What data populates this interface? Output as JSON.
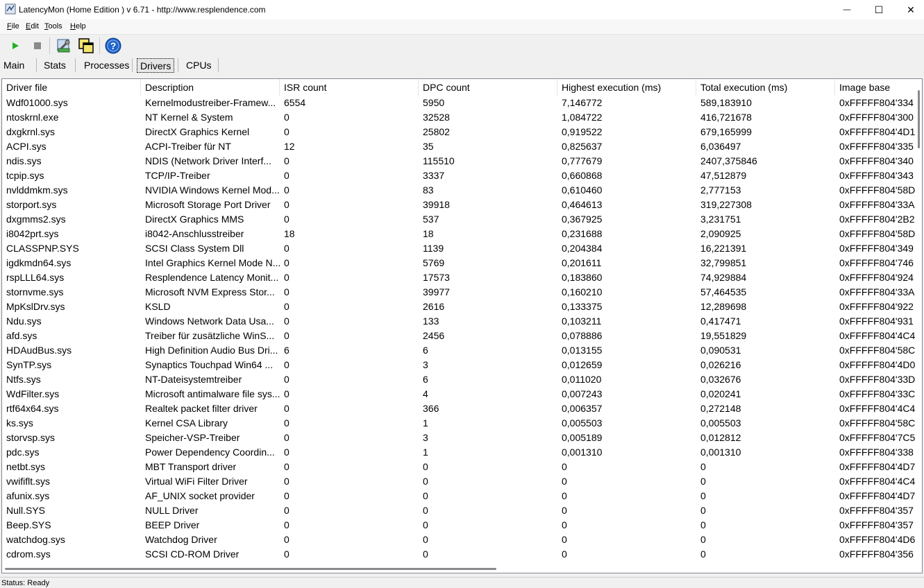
{
  "window": {
    "title": "LatencyMon  (Home Edition )  v 6.71 - http://www.resplendence.com",
    "minimize_glyph": "—",
    "maximize_glyph": "☐",
    "close_glyph": "✕"
  },
  "menu": [
    {
      "label": "File",
      "accel": "F",
      "rest": "ile"
    },
    {
      "label": "Edit",
      "accel": "E",
      "rest": "dit"
    },
    {
      "label": "Tools",
      "accel": "T",
      "rest": "ools"
    },
    {
      "label": "Help",
      "accel": "H",
      "rest": "elp"
    }
  ],
  "toolbar": {
    "icons": [
      "play-icon",
      "stop-icon",
      "tools-icon",
      "window-icon",
      "help-icon"
    ]
  },
  "tabs": [
    {
      "label": "Main",
      "active": false
    },
    {
      "label": "Stats",
      "active": false
    },
    {
      "label": "Processes",
      "active": false
    },
    {
      "label": "Drivers",
      "active": true
    },
    {
      "label": "CPUs",
      "active": false
    }
  ],
  "columns": [
    "Driver file",
    "Description",
    "ISR count",
    "DPC count",
    "Highest execution (ms)",
    "Total execution (ms)",
    "Image base"
  ],
  "rows": [
    [
      "Wdf01000.sys",
      "Kernelmodustreiber-Framew...",
      "6554",
      "5950",
      "7,146772",
      "589,183910",
      "0xFFFFF804'334"
    ],
    [
      "ntoskrnl.exe",
      "NT Kernel & System",
      "0",
      "32528",
      "1,084722",
      "416,721678",
      "0xFFFFF804'300"
    ],
    [
      "dxgkrnl.sys",
      "DirectX Graphics Kernel",
      "0",
      "25802",
      "0,919522",
      "679,165999",
      "0xFFFFF804'4D1"
    ],
    [
      "ACPI.sys",
      "ACPI-Treiber für NT",
      "12",
      "35",
      "0,825637",
      "6,036497",
      "0xFFFFF804'335"
    ],
    [
      "ndis.sys",
      "NDIS (Network Driver Interf...",
      "0",
      "115510",
      "0,777679",
      "2407,375846",
      "0xFFFFF804'340"
    ],
    [
      "tcpip.sys",
      "TCP/IP-Treiber",
      "0",
      "3337",
      "0,660868",
      "47,512879",
      "0xFFFFF804'343"
    ],
    [
      "nvlddmkm.sys",
      "NVIDIA Windows Kernel Mod...",
      "0",
      "83",
      "0,610460",
      "2,777153",
      "0xFFFFF804'58D"
    ],
    [
      "storport.sys",
      "Microsoft Storage Port Driver",
      "0",
      "39918",
      "0,464613",
      "319,227308",
      "0xFFFFF804'33A"
    ],
    [
      "dxgmms2.sys",
      "DirectX Graphics MMS",
      "0",
      "537",
      "0,367925",
      "3,231751",
      "0xFFFFF804'2B2"
    ],
    [
      "i8042prt.sys",
      "i8042-Anschlusstreiber",
      "18",
      "18",
      "0,231688",
      "2,090925",
      "0xFFFFF804'58D"
    ],
    [
      "CLASSPNP.SYS",
      "SCSI Class System Dll",
      "0",
      "1139",
      "0,204384",
      "16,221391",
      "0xFFFFF804'349"
    ],
    [
      "igdkmdn64.sys",
      "Intel Graphics Kernel Mode N...",
      "0",
      "5769",
      "0,201611",
      "32,799851",
      "0xFFFFF804'746"
    ],
    [
      "rspLLL64.sys",
      "Resplendence Latency Monit...",
      "0",
      "17573",
      "0,183860",
      "74,929884",
      "0xFFFFF804'924"
    ],
    [
      "stornvme.sys",
      "Microsoft NVM Express Stor...",
      "0",
      "39977",
      "0,160210",
      "57,464535",
      "0xFFFFF804'33A"
    ],
    [
      "MpKslDrv.sys",
      "KSLD",
      "0",
      "2616",
      "0,133375",
      "12,289698",
      "0xFFFFF804'922"
    ],
    [
      "Ndu.sys",
      "Windows Network Data Usa...",
      "0",
      "133",
      "0,103211",
      "0,417471",
      "0xFFFFF804'931"
    ],
    [
      "afd.sys",
      "Treiber für zusätzliche WinS...",
      "0",
      "2456",
      "0,078886",
      "19,551829",
      "0xFFFFF804'4C4"
    ],
    [
      "HDAudBus.sys",
      "High Definition Audio Bus Dri...",
      "6",
      "6",
      "0,013155",
      "0,090531",
      "0xFFFFF804'58C"
    ],
    [
      "SynTP.sys",
      "Synaptics Touchpad Win64 ...",
      "0",
      "3",
      "0,012659",
      "0,026216",
      "0xFFFFF804'4D0"
    ],
    [
      "Ntfs.sys",
      "NT-Dateisystemtreiber",
      "0",
      "6",
      "0,011020",
      "0,032676",
      "0xFFFFF804'33D"
    ],
    [
      "WdFilter.sys",
      "Microsoft antimalware file sys...",
      "0",
      "4",
      "0,007243",
      "0,020241",
      "0xFFFFF804'33C"
    ],
    [
      "rtf64x64.sys",
      "Realtek packet filter driver",
      "0",
      "366",
      "0,006357",
      "0,272148",
      "0xFFFFF804'4C4"
    ],
    [
      "ks.sys",
      "Kernel CSA Library",
      "0",
      "1",
      "0,005503",
      "0,005503",
      "0xFFFFF804'58C"
    ],
    [
      "storvsp.sys",
      "Speicher-VSP-Treiber",
      "0",
      "3",
      "0,005189",
      "0,012812",
      "0xFFFFF804'7C5"
    ],
    [
      "pdc.sys",
      "Power Dependency Coordin...",
      "0",
      "1",
      "0,001310",
      "0,001310",
      "0xFFFFF804'338"
    ],
    [
      "netbt.sys",
      "MBT Transport driver",
      "0",
      "0",
      "0",
      "0",
      "0xFFFFF804'4D7"
    ],
    [
      "vwififlt.sys",
      "Virtual WiFi Filter Driver",
      "0",
      "0",
      "0",
      "0",
      "0xFFFFF804'4C4"
    ],
    [
      "afunix.sys",
      "AF_UNIX socket provider",
      "0",
      "0",
      "0",
      "0",
      "0xFFFFF804'4D7"
    ],
    [
      "Null.SYS",
      "NULL Driver",
      "0",
      "0",
      "0",
      "0",
      "0xFFFFF804'357"
    ],
    [
      "Beep.SYS",
      "BEEP Driver",
      "0",
      "0",
      "0",
      "0",
      "0xFFFFF804'357"
    ],
    [
      "watchdog.sys",
      "Watchdog Driver",
      "0",
      "0",
      "0",
      "0",
      "0xFFFFF804'4D6"
    ],
    [
      "cdrom.sys",
      "SCSI CD-ROM Driver",
      "0",
      "0",
      "0",
      "0",
      "0xFFFFF804'356"
    ]
  ],
  "status": "Status: Ready",
  "colors": {
    "play": "#22b122",
    "stop": "#8a8a8a",
    "help": "#1e63c8"
  }
}
